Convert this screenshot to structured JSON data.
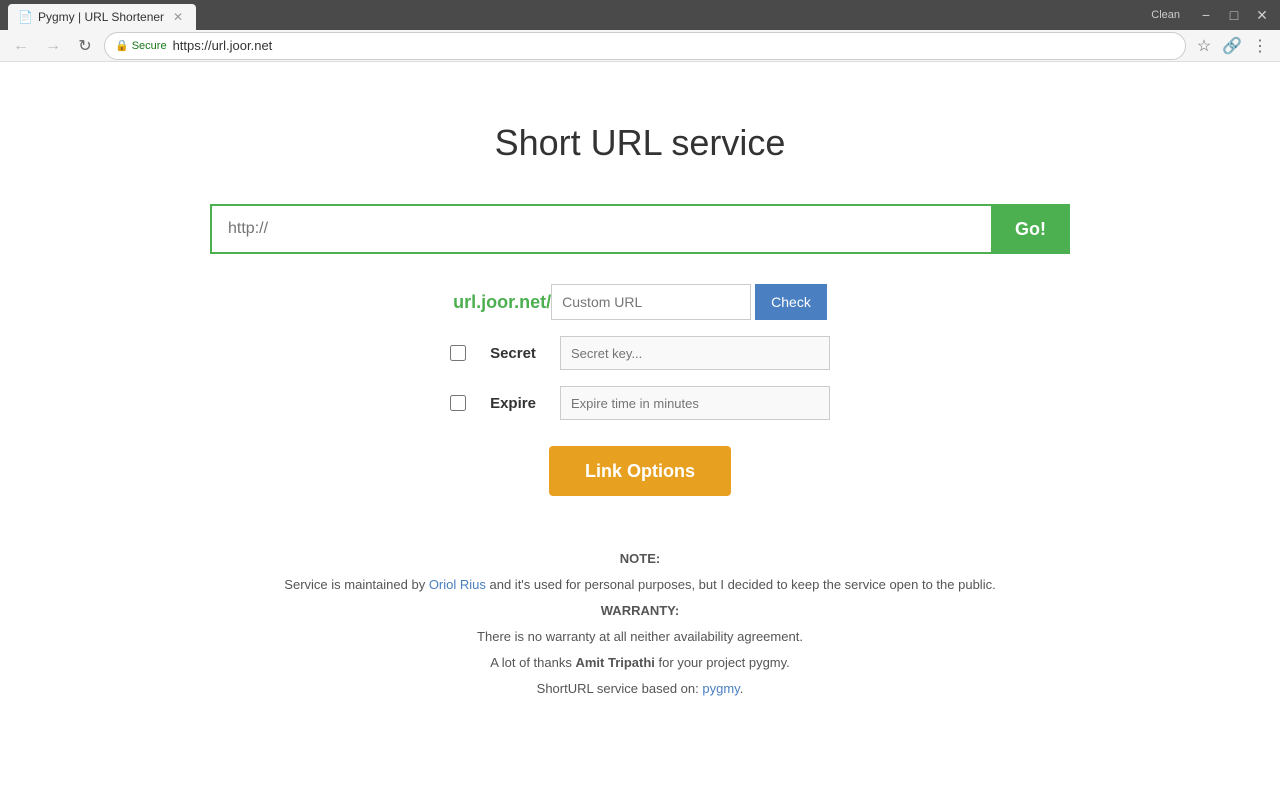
{
  "browser": {
    "tab_title": "Pygmy | URL Shortener",
    "favicon": "📄",
    "url": "https://url.joor.net",
    "secure_label": "Secure",
    "clean_label": "Clean",
    "controls": {
      "minimize": "−",
      "maximize": "□",
      "close": "✕"
    }
  },
  "page": {
    "title": "Short URL service",
    "url_input_placeholder": "http://",
    "go_button_label": "Go!",
    "base_url": "url.joor.net/",
    "custom_url_placeholder": "Custom URL",
    "check_button_label": "Check",
    "secret_label": "Secret",
    "secret_placeholder": "Secret key...",
    "expire_label": "Expire",
    "expire_placeholder": "Expire time in minutes",
    "link_options_label": "Link Options"
  },
  "footer": {
    "note_label": "NOTE:",
    "note_text_before": "Service is maintained by ",
    "note_author": "Oriol Rius",
    "note_text_after": " and it's used for personal purposes, but I decided to keep the service open to the public.",
    "warranty_label": "WARRANTY:",
    "warranty_text": "There is no warranty at all neither availability agreement.",
    "thanks_before": "A lot of thanks ",
    "thanks_author": "Amit Tripathi",
    "thanks_after": " for your project pygmy.",
    "based_on_before": "ShortURL service based on: ",
    "based_on_link": "pygmy",
    "based_on_after": "."
  }
}
